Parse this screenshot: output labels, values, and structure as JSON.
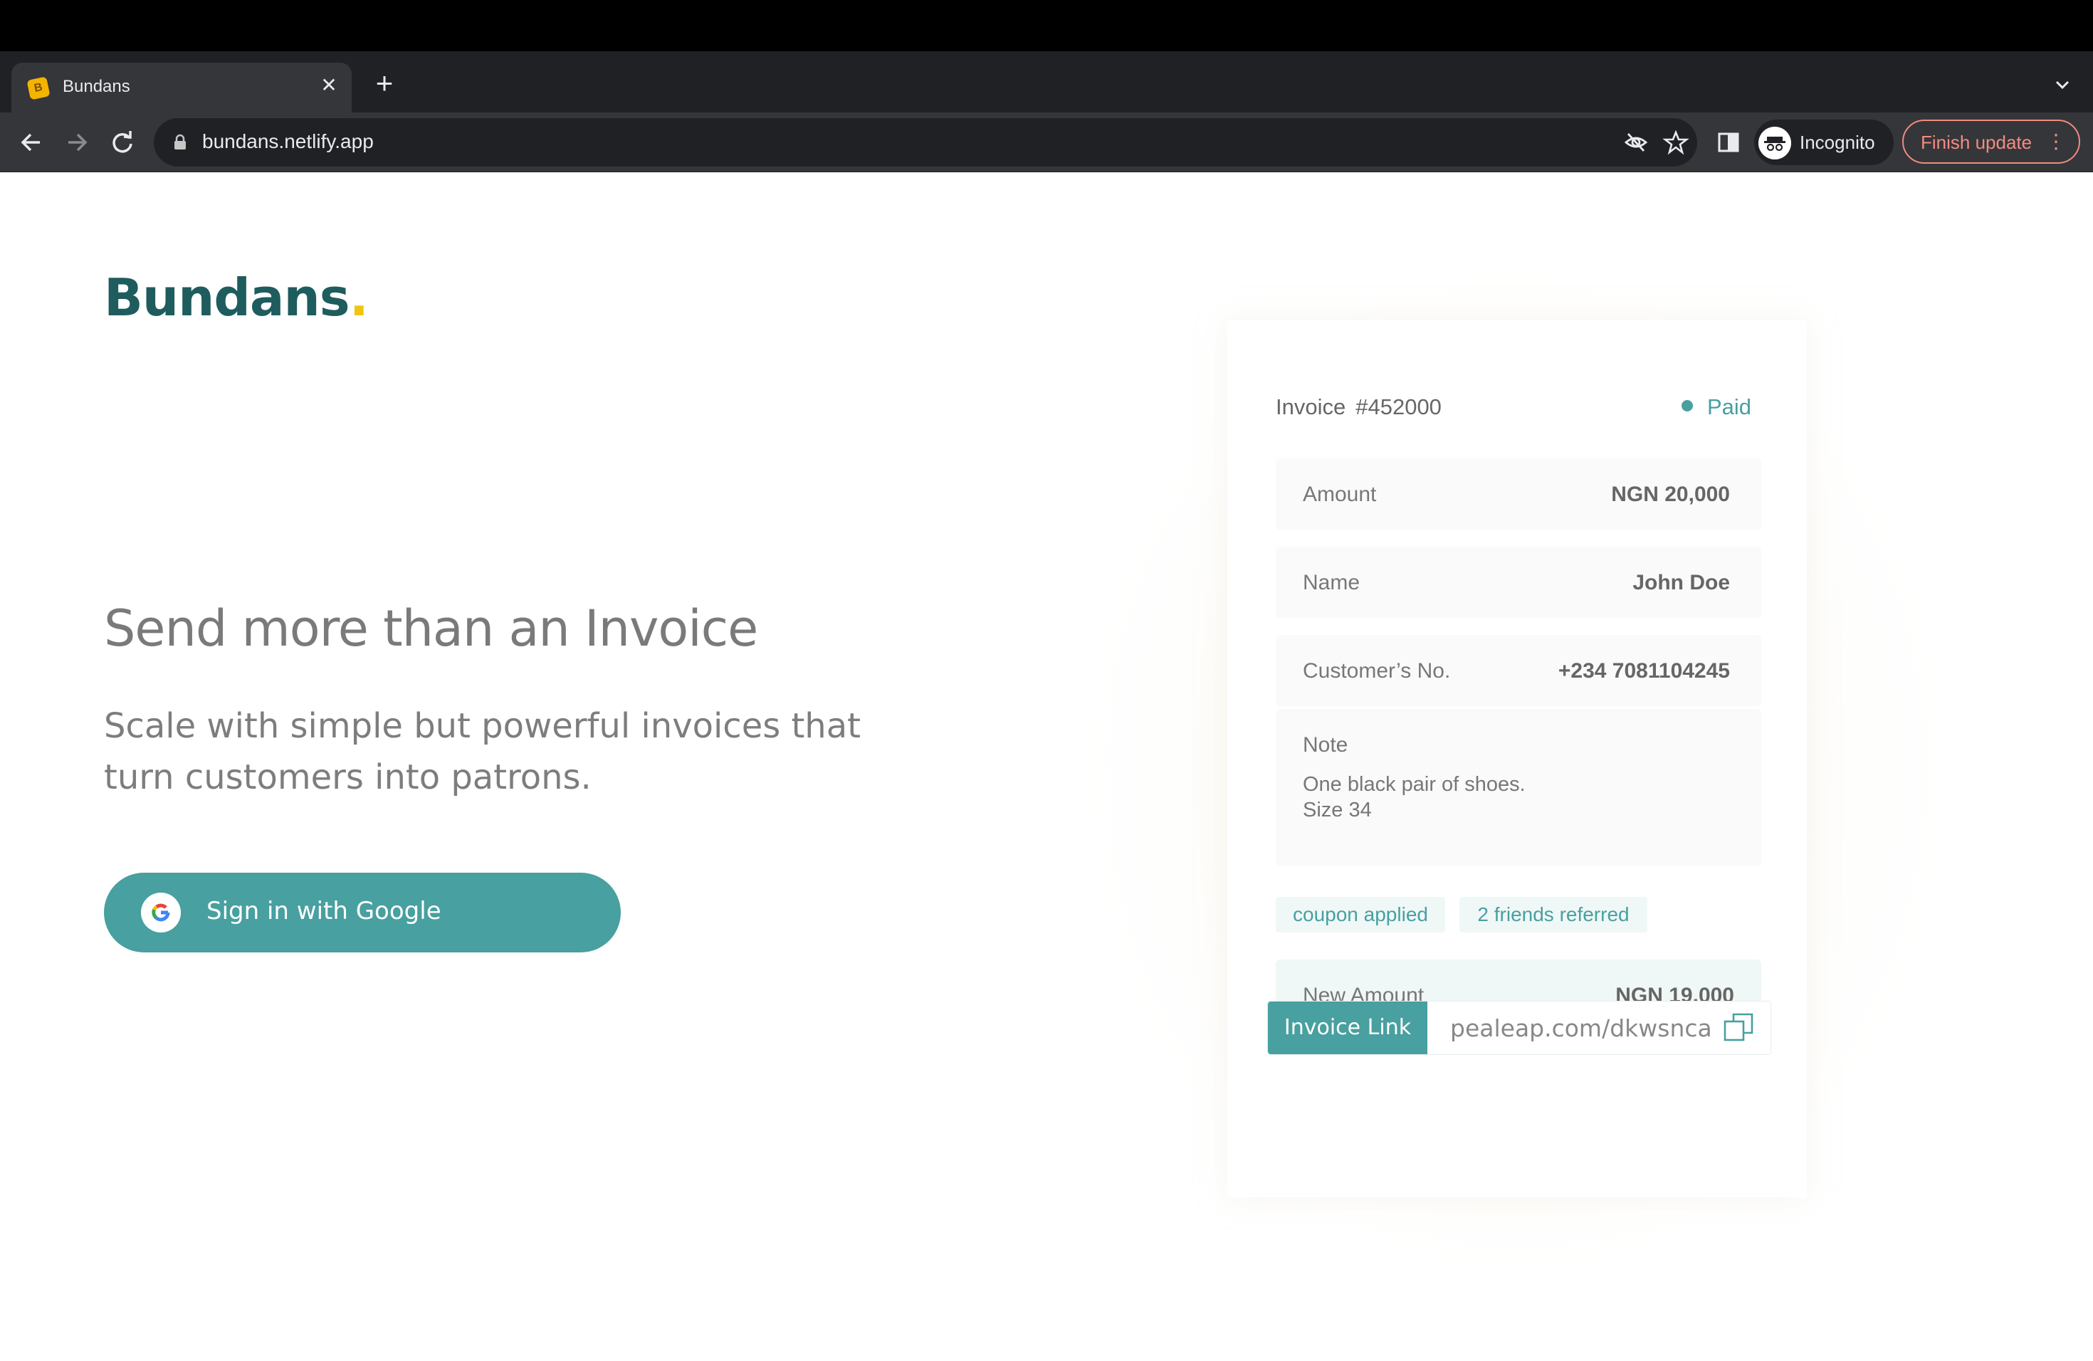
{
  "browser": {
    "tab_title": "Bundans",
    "url": "bundans.netlify.app",
    "incognito_label": "Incognito",
    "finish_update_label": "Finish update",
    "icons": [
      "back-icon",
      "forward-icon",
      "reload-icon",
      "lock-icon",
      "eye-off-icon",
      "star-icon",
      "side-panel-icon",
      "incognito-icon",
      "more-icon",
      "close-icon",
      "plus-icon",
      "chevron-down-icon"
    ]
  },
  "page": {
    "logo": {
      "text": "Bundans",
      "dot": ".",
      "color": "#1e5c5e",
      "dot_color": "#f2c40f"
    },
    "hero_title": "Send more than an Invoice",
    "hero_subtitle_line1": "Scale with simple but powerful invoices that",
    "hero_subtitle_line2": "turn customers into patrons.",
    "google_button_label": "Sign in with Google",
    "accent_color": "#48a0a0"
  },
  "invoice": {
    "label": "Invoice",
    "number": "#452000",
    "status": "Paid",
    "rows": [
      {
        "label": "Amount",
        "value": "NGN  20,000"
      },
      {
        "label": "Name",
        "value": "John Doe"
      },
      {
        "label": "Customer’s No.",
        "value": "+234 7081104245"
      }
    ],
    "note": {
      "title": "Note",
      "line1": "One black pair of shoes.",
      "line2": "Size 34"
    },
    "chips": [
      "coupon applied",
      "2 friends referred"
    ],
    "new_amount": {
      "label": "New Amount",
      "value": "NGN  19,000"
    },
    "link": {
      "label": "Invoice Link",
      "url": "pealeap.com/dkwsnca"
    }
  }
}
